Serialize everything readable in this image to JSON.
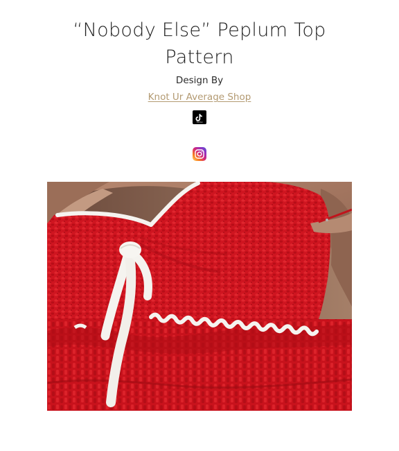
{
  "header": {
    "title_line1": "“Nobody Else” Peplum Top",
    "title_line2": "Pattern",
    "design_by": "Design By",
    "shop_link": "Knot Ur Average Shop"
  },
  "social": {
    "tiktok": {
      "icon": "tiktok-icon",
      "caption": "TikTok"
    },
    "instagram": {
      "icon": "instagram-icon"
    }
  },
  "colors": {
    "link": "#b39a72",
    "crochet_red": "#d0141e",
    "trim_white": "#f5f3ef"
  }
}
